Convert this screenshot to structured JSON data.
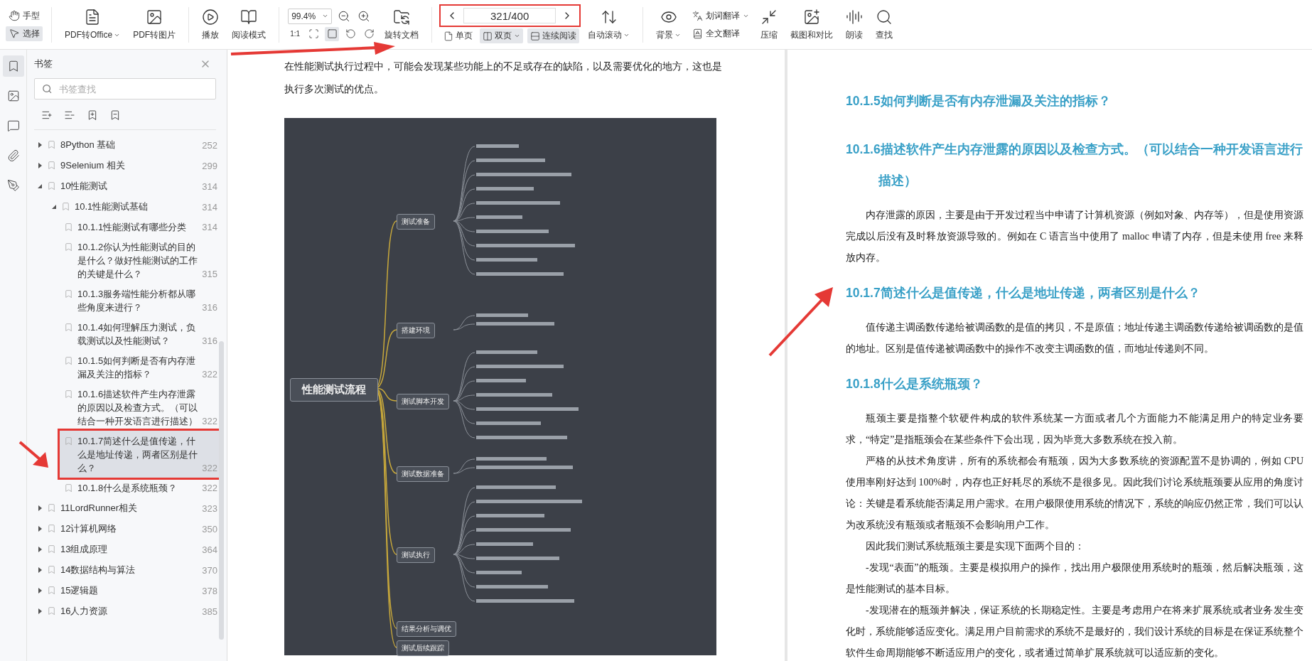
{
  "toolbar": {
    "mode_tools": [
      {
        "label": "手型",
        "selected": false
      },
      {
        "label": "选择",
        "selected": true
      }
    ],
    "convert_buttons": [
      {
        "label": "PDF转Office",
        "dropdown": true
      },
      {
        "label": "PDF转图片",
        "dropdown": false
      }
    ],
    "view_buttons": [
      {
        "label": "播放"
      },
      {
        "label": "阅读模式"
      }
    ],
    "zoom": {
      "value": "99.4%"
    },
    "fit_tools": [
      {
        "kind": "text",
        "label": "1:1",
        "selected": false
      },
      {
        "kind": "icon",
        "selected": false
      },
      {
        "kind": "icon",
        "selected": true
      },
      {
        "kind": "icon",
        "selected": false
      },
      {
        "kind": "icon",
        "selected": false
      }
    ],
    "rotate_button": {
      "label": "旋转文档"
    },
    "page_nav": {
      "page": "321/400",
      "highlighted": true
    },
    "layout_modes": [
      {
        "label": "单页",
        "selected": false,
        "dropdown": false
      },
      {
        "label": "双页",
        "selected": true,
        "dropdown": true
      },
      {
        "label": "连续阅读",
        "selected": true,
        "dropdown": false
      }
    ],
    "auto_scroll": {
      "label": "自动滚动",
      "dropdown": true
    },
    "background_button": {
      "label": "背景",
      "dropdown": true
    },
    "translate_buttons": [
      {
        "label": "划词翻译",
        "dropdown": true
      },
      {
        "label": "全文翻译",
        "dropdown": false
      }
    ],
    "tools": [
      {
        "label": "压缩"
      },
      {
        "label": "截图和对比"
      },
      {
        "label": "朗读"
      },
      {
        "label": "查找"
      }
    ]
  },
  "rail": [
    {
      "selected": true
    },
    {
      "selected": false
    },
    {
      "selected": false
    },
    {
      "selected": false
    },
    {
      "selected": false
    }
  ],
  "bookmarks": {
    "title": "书签",
    "search": {
      "placeholder": "书签查找"
    },
    "items": [
      {
        "title": "8Python 基础",
        "page": "252",
        "expanded": false,
        "selected": false,
        "highlighted": false
      },
      {
        "title": "9Selenium 相关",
        "page": "299",
        "expanded": false,
        "selected": false,
        "highlighted": false
      },
      {
        "title": "10性能测试",
        "page": "314",
        "expanded": true,
        "selected": false,
        "highlighted": false,
        "children": [
          {
            "title": "10.1性能测试基础",
            "page": "314",
            "expanded": true,
            "selected": false,
            "highlighted": false,
            "children": [
              {
                "title": "10.1.1性能测试有哪些分类",
                "page": "314",
                "selected": false,
                "highlighted": false
              },
              {
                "title": "10.1.2你认为性能测试的目的是什么？做好性能测试的工作的关键是什么？",
                "page": "315",
                "selected": false,
                "highlighted": false
              },
              {
                "title": "10.1.3服务端性能分析都从哪些角度来进行？",
                "page": "316",
                "selected": false,
                "highlighted": false
              },
              {
                "title": "10.1.4如何理解压力测试，负载测试以及性能测试？",
                "page": "316",
                "selected": false,
                "highlighted": false
              },
              {
                "title": "10.1.5如何判断是否有内存泄漏及关注的指标？",
                "page": "322",
                "selected": false,
                "highlighted": false
              },
              {
                "title": "10.1.6描述软件产生内存泄露的原因以及检查方式。（可以结合一种开发语言进行描述）",
                "page": "322",
                "selected": false,
                "highlighted": false
              },
              {
                "title": "10.1.7简述什么是值传递，什么是地址传递，两者区别是什么？",
                "page": "322",
                "selected": true,
                "highlighted": true
              },
              {
                "title": "10.1.8什么是系统瓶颈？",
                "page": "322",
                "selected": false,
                "highlighted": false
              }
            ]
          }
        ]
      },
      {
        "title": "11LordRunner相关",
        "page": "323",
        "expanded": false,
        "selected": false,
        "highlighted": false
      },
      {
        "title": "12计算机网络",
        "page": "350",
        "expanded": false,
        "selected": false,
        "highlighted": false
      },
      {
        "title": "13组成原理",
        "page": "364",
        "expanded": false,
        "selected": false,
        "highlighted": false
      },
      {
        "title": "14数据结构与算法",
        "page": "370",
        "expanded": false,
        "selected": false,
        "highlighted": false
      },
      {
        "title": "15逻辑题",
        "page": "378",
        "expanded": false,
        "selected": false,
        "highlighted": false
      },
      {
        "title": "16人力资源",
        "page": "385",
        "expanded": false,
        "selected": false,
        "highlighted": false
      }
    ]
  },
  "left_page": {
    "paragraph": "在性能测试执行过程中，可能会发现某些功能上的不足或存在的缺陷，以及需要优化的地方，这也是执行多次测试的优点。",
    "mindmap": {
      "center": "性能测试流程",
      "branches": [
        "测试准备",
        "搭建环境",
        "测试脚本开发",
        "测试数据准备",
        "测试执行",
        "结果分析与调优",
        "测试后续跟踪"
      ]
    }
  },
  "right_page": {
    "blocks": [
      {
        "kind": "heading",
        "text": "10.1.5如何判断是否有内存泄漏及关注的指标？"
      },
      {
        "kind": "heading",
        "text": "10.1.6描述软件产生内存泄露的原因以及检查方式。（可以结合一种开发语言进行描述）"
      },
      {
        "kind": "paragraph",
        "text": "内存泄露的原因，主要是由于开发过程当中申请了计算机资源（例如对象、内存等），但是使用资源完成以后没有及时释放资源导致的。例如在 C 语言当中使用了 malloc 申请了内存，但是未使用 free 来释放内存。"
      },
      {
        "kind": "heading",
        "text": "10.1.7简述什么是值传递，什么是地址传递，两者区别是什么？"
      },
      {
        "kind": "paragraph",
        "text": "值传递主调函数传递给被调函数的是值的拷贝，不是原值；地址传递主调函数传递给被调函数的是值的地址。区别是值传递被调函数中的操作不改变主调函数的值，而地址传递则不同。"
      },
      {
        "kind": "heading",
        "text": "10.1.8什么是系统瓶颈？"
      },
      {
        "kind": "paragraph",
        "text": "瓶颈主要是指整个软硬件构成的软件系统某一方面或者几个方面能力不能满足用户的特定业务要求，“特定”是指瓶颈会在某些条件下会出现，因为毕竟大多数系统在投入前。"
      },
      {
        "kind": "paragraph",
        "text": "严格的从技术角度讲，所有的系统都会有瓶颈，因为大多数系统的资源配置不是协调的，例如 CPU 使用率刚好达到 100%时，内存也正好耗尽的系统不是很多见。因此我们讨论系统瓶颈要从应用的角度讨论：关键是看系统能否满足用户需求。在用户极限使用系统的情况下，系统的响应仍然正常，我们可以认为改系统没有瓶颈或者瓶颈不会影响用户工作。"
      },
      {
        "kind": "paragraph",
        "text": "因此我们测试系统瓶颈主要是实现下面两个目的："
      },
      {
        "kind": "paragraph",
        "text": "-发现“表面”的瓶颈。主要是模拟用户的操作，找出用户极限使用系统时的瓶颈，然后解决瓶颈，这是性能测试的基本目标。"
      },
      {
        "kind": "paragraph",
        "text": "-发现潜在的瓶颈并解决，保证系统的长期稳定性。主要是考虑用户在将来扩展系统或者业务发生变化时，系统能够适应变化。满足用户目前需求的系统不是最好的，我们设计系统的目标是在保证系统整个软件生命周期能够不断适应用户的变化，或者通过简单扩展系统就可以适应新的变化。"
      }
    ]
  }
}
